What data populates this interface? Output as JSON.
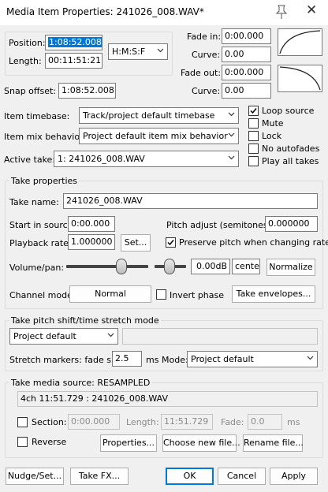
{
  "window": {
    "title": "Media Item Properties:  241026_008.WAV*",
    "icons": {
      "pin": "pin-icon",
      "close": "close-icon"
    }
  },
  "position": {
    "position_label": "Position:",
    "position_value": "1:08:52.008",
    "length_label": "Length:",
    "length_value": "00:11:51:21",
    "time_format": "H:M:S:F"
  },
  "fades": {
    "fade_in_label": "Fade in:",
    "fade_in_value": "0:00.000",
    "curve_in_label": "Curve:",
    "curve_in_value": "0.00",
    "fade_out_label": "Fade out:",
    "fade_out_value": "0:00.000",
    "curve_out_label": "Curve:",
    "curve_out_value": "0.00"
  },
  "snap": {
    "label": "Snap offset:",
    "value": "1:08:52.008"
  },
  "item": {
    "timebase_label": "Item timebase:",
    "timebase_value": "Track/project default timebase",
    "mix_label": "Item mix behavior:",
    "mix_value": "Project default item mix behavior",
    "active_take_label": "Active take:",
    "active_take_value": "1: 241026_008.WAV"
  },
  "options": {
    "loop_source": "Loop source",
    "mute": "Mute",
    "lock": "Lock",
    "no_autofades": "No autofades",
    "play_all_takes": "Play all takes"
  },
  "take": {
    "group_title": "Take properties",
    "name_label": "Take name:",
    "name_value": "241026_008.WAV",
    "start_label": "Start in source:",
    "start_value": "0:00.000",
    "pitch_label": "Pitch adjust (semitones):",
    "pitch_value": "0.000000",
    "rate_label": "Playback rate:",
    "rate_value": "1.000000",
    "set_button": "Set...",
    "preserve_pitch": "Preserve pitch when changing rate",
    "volpan_label": "Volume/pan:",
    "volume_db": "0.00dB",
    "pan_value": "center",
    "normalize_button": "Normalize",
    "channel_label": "Channel mode:",
    "channel_value": "Normal",
    "invert_phase": "Invert phase",
    "envelopes_button": "Take envelopes..."
  },
  "pitch_shift": {
    "group_title": "Take pitch shift/time stretch mode",
    "mode_value": "Project default",
    "markers_label": "Stretch markers: fade size:",
    "fade_size_value": "2.5",
    "ms_label": "ms",
    "mode_label": "Mode:",
    "stretch_mode_value": "Project default"
  },
  "media_source": {
    "group_title": "Take media source:  RESAMPLED",
    "source_value": "4ch 11:51.729 : 241026_008.WAV",
    "section_label": "Section:",
    "section_value": "0:00.000",
    "length_label": "Length:",
    "length_value": "11:51.729",
    "fade_label": "Fade:",
    "fade_value": "0.0",
    "ms_label": "ms",
    "reverse_label": "Reverse",
    "properties_button": "Properties...",
    "choose_file_button": "Choose new file...",
    "rename_file_button": "Rename file..."
  },
  "footer": {
    "nudge_button": "Nudge/Set...",
    "take_fx_button": "Take FX...",
    "ok_button": "OK",
    "cancel_button": "Cancel",
    "apply_button": "Apply"
  },
  "state": {
    "loop_source_checked": true,
    "mute_checked": false,
    "lock_checked": false,
    "no_autofades_checked": false,
    "play_all_takes_checked": false,
    "preserve_pitch_checked": true,
    "invert_phase_checked": false,
    "section_checked": false,
    "reverse_checked": false
  },
  "colors": {
    "accent": "#0078d7",
    "background": "#f0f0f0"
  }
}
